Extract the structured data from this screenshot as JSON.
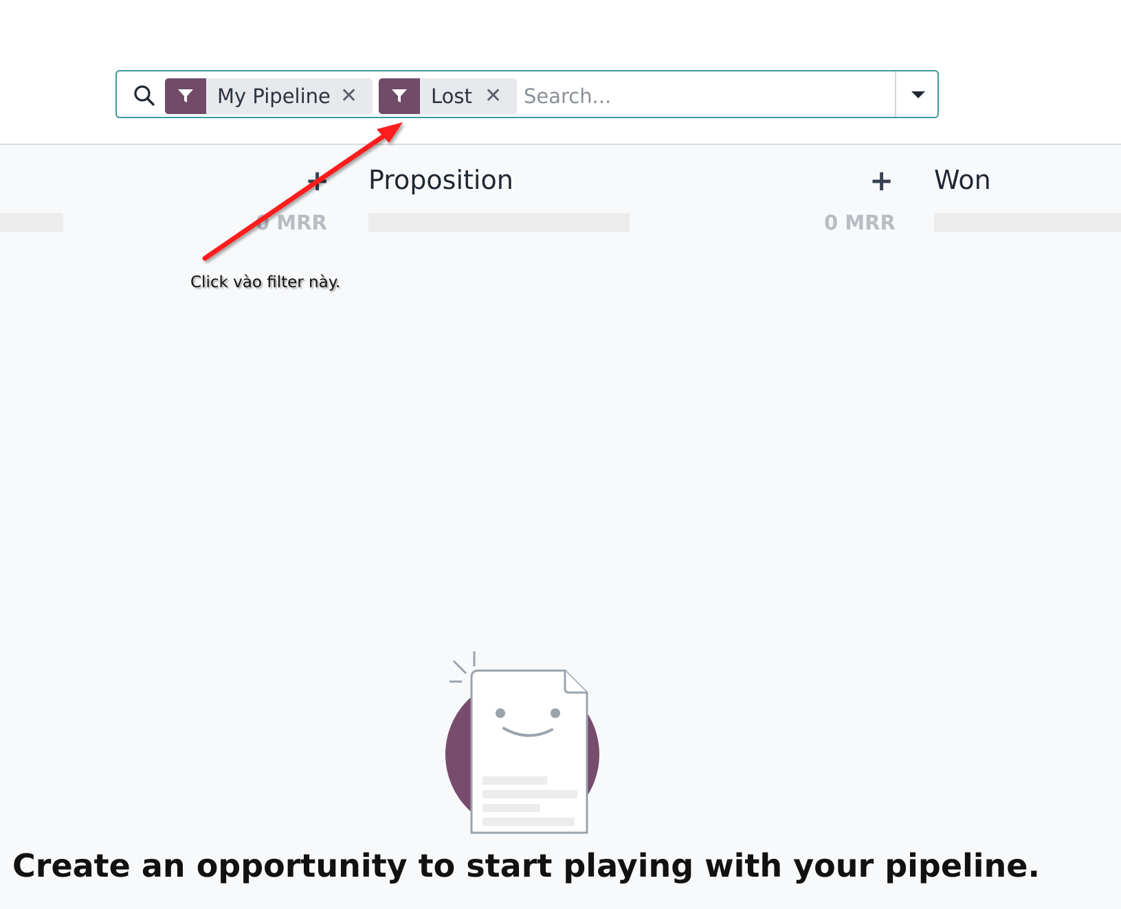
{
  "search": {
    "facets": [
      {
        "label": "My Pipeline",
        "icon": "filter-icon"
      },
      {
        "label": "Lost",
        "icon": "filter-icon"
      }
    ],
    "placeholder": "Search..."
  },
  "columns": [
    {
      "title": "",
      "mrr": "0 MRR"
    },
    {
      "title": "Proposition",
      "mrr": "0 MRR"
    },
    {
      "title": "Won",
      "mrr": ""
    }
  ],
  "annotation": {
    "text": "Click vào  filter này.",
    "arrow_color": "#ff0000"
  },
  "empty_state": {
    "title": "Create an opportunity to start playing with your pipeline."
  },
  "colors": {
    "accent": "#714b67",
    "border": "#3d9a9a"
  }
}
